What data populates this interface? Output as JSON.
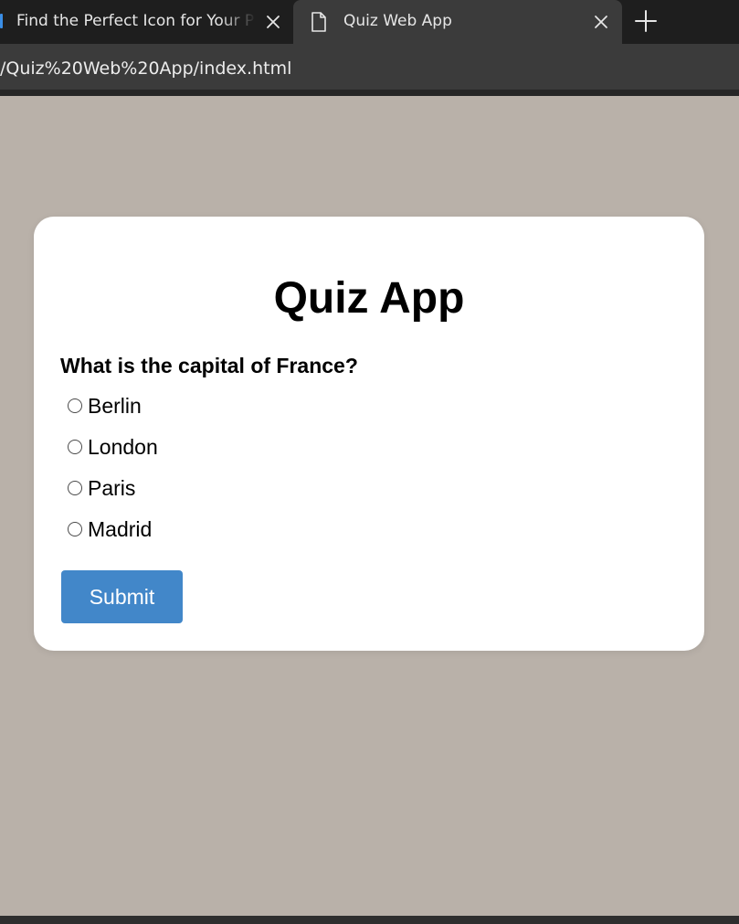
{
  "browser": {
    "tabs": [
      {
        "title": "Find the Perfect Icon for Your Project",
        "active": false
      },
      {
        "title": "Quiz Web App",
        "active": true
      }
    ],
    "address": "/Quiz%20Web%20App/index.html",
    "accent_color": "#3a8ee6"
  },
  "quiz": {
    "title": "Quiz App",
    "question": "What is the capital of France?",
    "options": [
      "Berlin",
      "London",
      "Paris",
      "Madrid"
    ],
    "submit_label": "Submit",
    "button_color": "#4287c9",
    "background_color": "#b9b1a9"
  }
}
